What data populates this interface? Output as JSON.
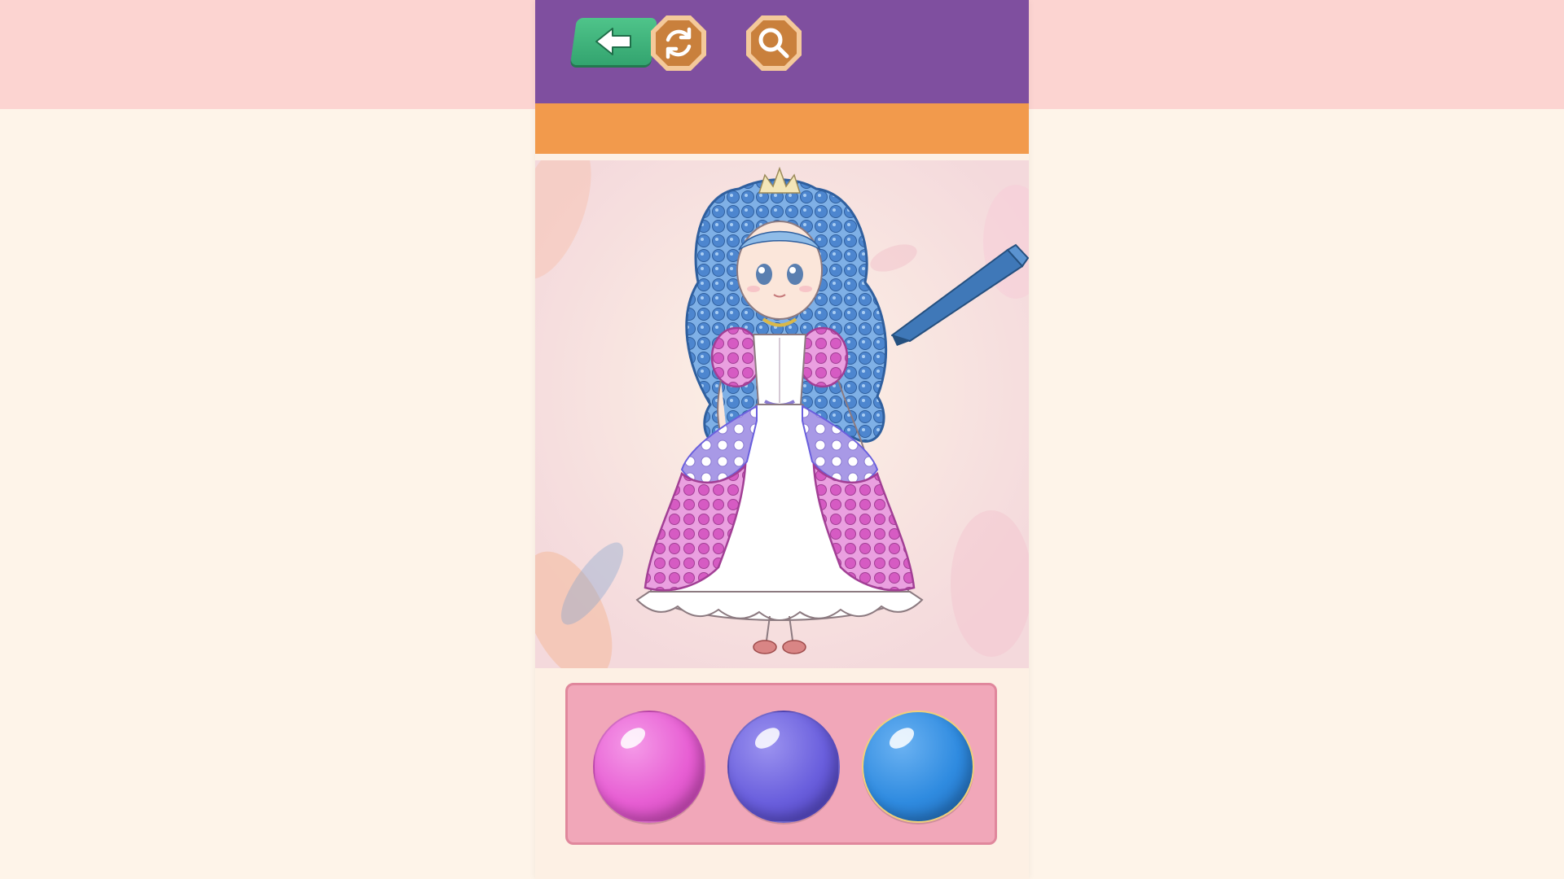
{
  "screen": {
    "background": "#fef4e9",
    "top_band_color": "#fcd4d1"
  },
  "toolbar": {
    "color": "#7f4f9f",
    "accent_bar_color": "#f29a4c",
    "buttons": [
      {
        "icon": "arrow-left-icon",
        "color": "#3fb57c"
      },
      {
        "icon": "refresh-icon",
        "color": "#c9803c"
      },
      {
        "icon": "search-icon",
        "color": "#c9803c"
      }
    ]
  },
  "canvas": {
    "subject": "princess",
    "hair_color": "#5a8fd6",
    "dress_pink": "#e07ccf",
    "dress_lilac": "#9d8ce0"
  },
  "tool": {
    "icon": "brush-icon",
    "color": "#3f78b8"
  },
  "palette": {
    "tray_color": "#f1a7b9",
    "colors": [
      {
        "name": "pink",
        "hex": "#e75ed3"
      },
      {
        "name": "purple",
        "hex": "#6a5fdd"
      },
      {
        "name": "blue",
        "hex": "#2f8be0"
      }
    ]
  }
}
